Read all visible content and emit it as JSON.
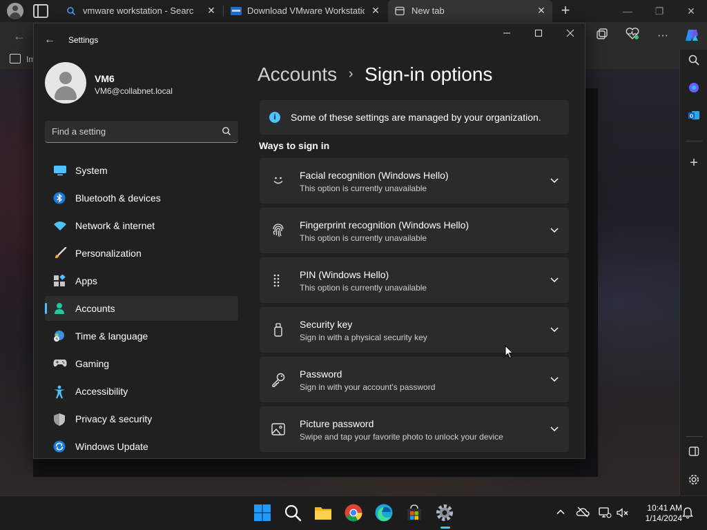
{
  "browser": {
    "tabs": [
      {
        "label": "vmware workstation - Search",
        "icon": "search-icon"
      },
      {
        "label": "Download VMware Workstation",
        "icon": "vmware-icon"
      },
      {
        "label": "New tab",
        "icon": "new-tab-icon"
      }
    ],
    "favorites_label": "Im"
  },
  "settings": {
    "window_title": "Settings",
    "user": {
      "name": "VM6",
      "email": "VM6@collabnet.local"
    },
    "search_placeholder": "Find a setting",
    "nav": [
      {
        "label": "System",
        "icon": "system-icon"
      },
      {
        "label": "Bluetooth & devices",
        "icon": "bluetooth-icon"
      },
      {
        "label": "Network & internet",
        "icon": "wifi-icon"
      },
      {
        "label": "Personalization",
        "icon": "brush-icon"
      },
      {
        "label": "Apps",
        "icon": "apps-icon"
      },
      {
        "label": "Accounts",
        "icon": "accounts-icon",
        "active": true
      },
      {
        "label": "Time & language",
        "icon": "globe-clock-icon"
      },
      {
        "label": "Gaming",
        "icon": "gamepad-icon"
      },
      {
        "label": "Accessibility",
        "icon": "accessibility-icon"
      },
      {
        "label": "Privacy & security",
        "icon": "shield-icon"
      },
      {
        "label": "Windows Update",
        "icon": "update-icon"
      }
    ],
    "breadcrumb": {
      "parent": "Accounts",
      "separator": "›",
      "current": "Sign-in options"
    },
    "info_banner": "Some of these settings are managed by your organization.",
    "section_heading": "Ways to sign in",
    "options": [
      {
        "title": "Facial recognition (Windows Hello)",
        "subtitle": "This option is currently unavailable",
        "icon": "face-icon"
      },
      {
        "title": "Fingerprint recognition (Windows Hello)",
        "subtitle": "This option is currently unavailable",
        "icon": "fingerprint-icon"
      },
      {
        "title": "PIN (Windows Hello)",
        "subtitle": "This option is currently unavailable",
        "icon": "pin-keypad-icon"
      },
      {
        "title": "Security key",
        "subtitle": "Sign in with a physical security key",
        "icon": "usb-key-icon"
      },
      {
        "title": "Password",
        "subtitle": "Sign in with your account's password",
        "icon": "key-icon"
      },
      {
        "title": "Picture password",
        "subtitle": "Swipe and tap your favorite photo to unlock your device",
        "icon": "picture-icon"
      }
    ]
  },
  "taskbar": {
    "time": "10:41 AM",
    "date": "1/14/2024"
  },
  "colors": {
    "accent": "#4cc2ff",
    "window_bg": "#202020",
    "card_bg": "#2b2b2b"
  }
}
